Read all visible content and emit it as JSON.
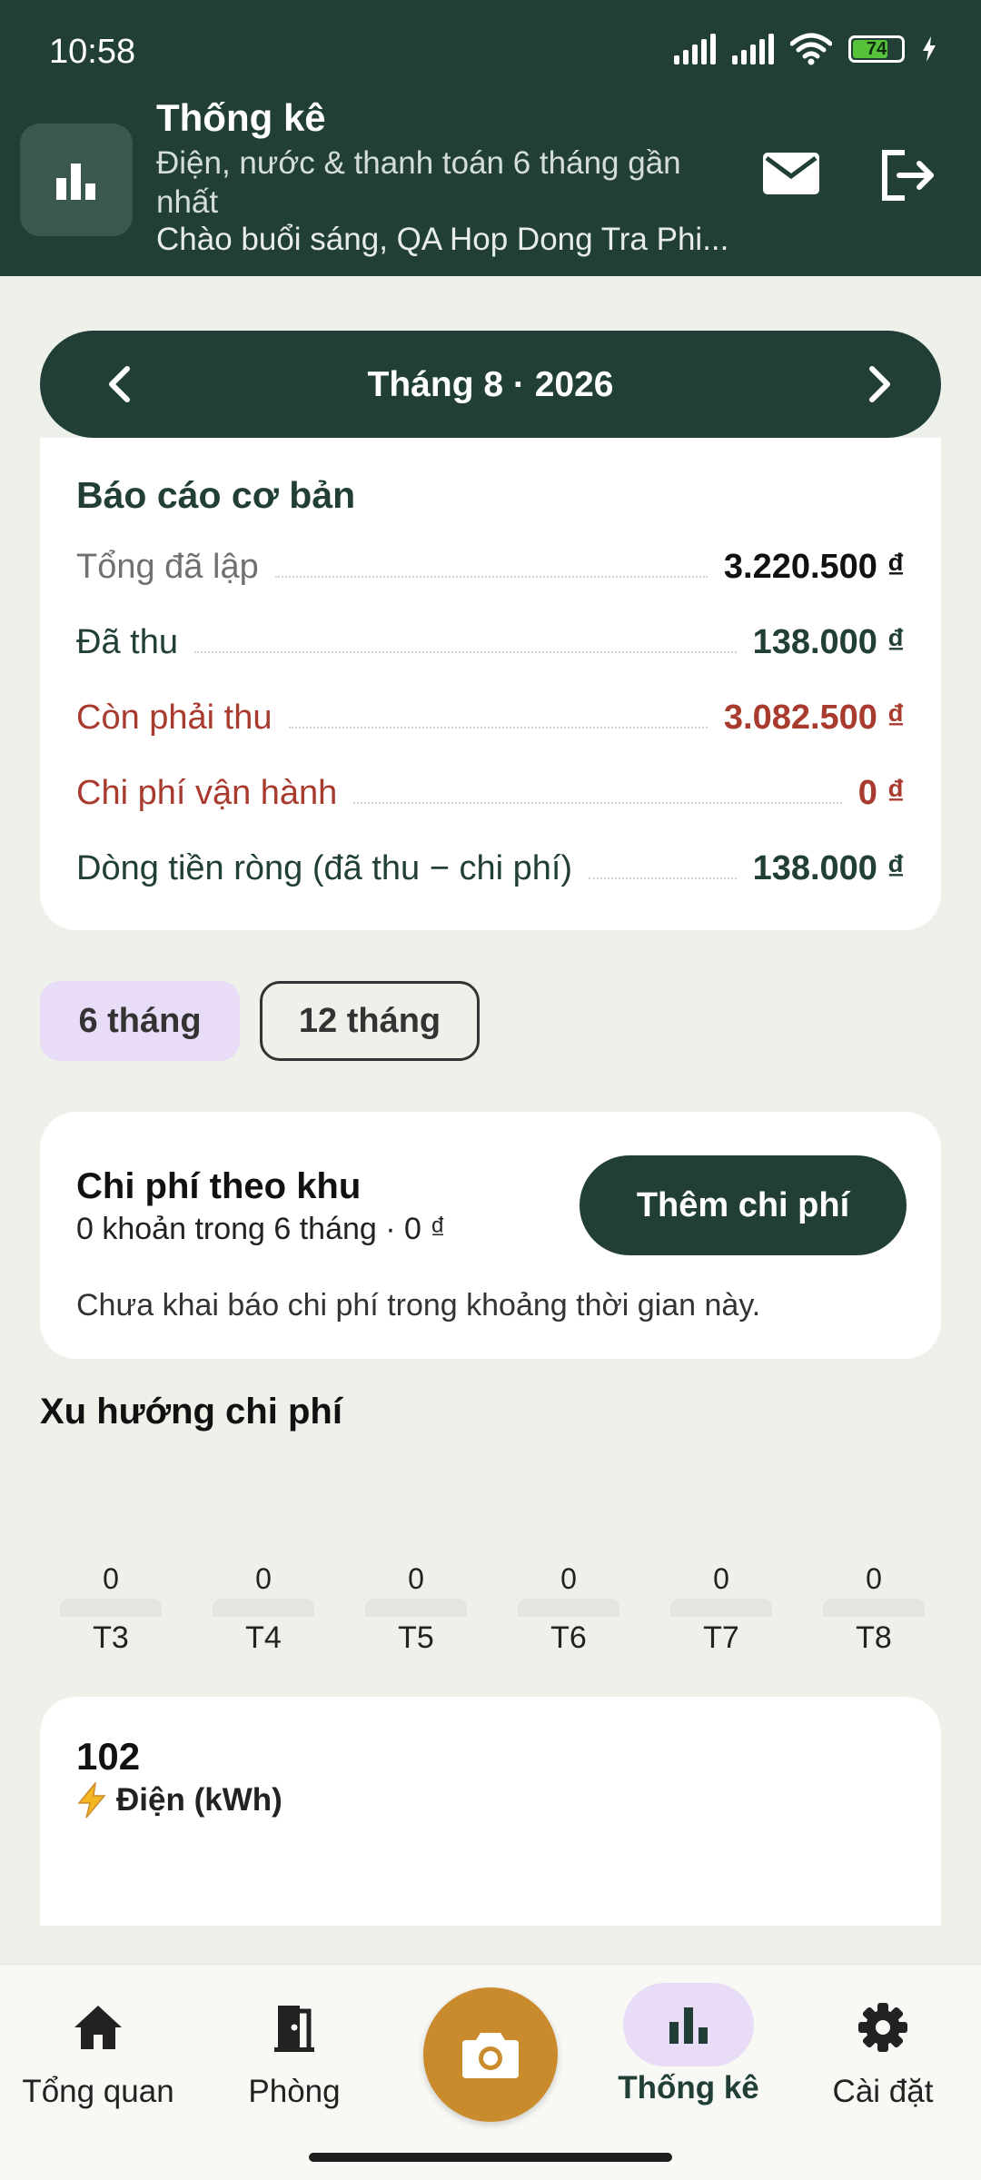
{
  "status_bar": {
    "time": "10:58",
    "battery": "74",
    "battery_level": 0.74
  },
  "header": {
    "title": "Thống kê",
    "subtitle": "Điện, nước & thanh toán 6 tháng gần nhất",
    "greeting": "Chào buổi sáng, QA Hop Dong Tra Phi...",
    "icons": {
      "app": "bar-chart-icon",
      "mail": "mail-icon",
      "logout": "logout-icon"
    }
  },
  "month_nav": {
    "label": "Tháng 8 · 2026"
  },
  "report": {
    "title": "Báo cáo cơ bản",
    "rows": [
      {
        "label": "Tổng đã lập",
        "value": "3.220.500 ₫"
      },
      {
        "label": "Đã thu",
        "value": "138.000 ₫"
      },
      {
        "label": "Còn phải thu",
        "value": "3.082.500 ₫"
      },
      {
        "label": "Chi phí vận hành",
        "value": "0 ₫"
      },
      {
        "label": "Dòng tiền ròng (đã thu − chi phí)",
        "value": "138.000 ₫"
      }
    ]
  },
  "period": {
    "six": "6 tháng",
    "twelve": "12 tháng",
    "selected": "6 tháng"
  },
  "expense": {
    "title": "Chi phí theo khu",
    "subtitle": "0 khoản trong 6 tháng · 0 ₫",
    "add_label": "Thêm chi phí",
    "empty_note": "Chưa khai báo chi phí trong khoảng thời gian này."
  },
  "trend": {
    "title": "Xu hướng chi phí",
    "chart_data": {
      "type": "bar",
      "title": "Xu hướng chi phí",
      "categories": [
        "T3",
        "T4",
        "T5",
        "T6",
        "T7",
        "T8"
      ],
      "values": [
        0,
        0,
        0,
        0,
        0,
        0
      ]
    }
  },
  "electric": {
    "value": "102",
    "icon": "lightning-icon",
    "label": "Điện (kWh)"
  },
  "bottom_nav": {
    "items": [
      {
        "label": "Tổng quan",
        "icon": "home-icon"
      },
      {
        "label": "Phòng",
        "icon": "door-icon"
      },
      {
        "label": "Thống kê",
        "icon": "bar-chart-icon",
        "active": true
      },
      {
        "label": "Cài đặt",
        "icon": "gear-icon"
      }
    ],
    "camera_icon": "camera-icon"
  },
  "colors": {
    "primary": "#213f37",
    "background": "#eef0ea",
    "danger": "#a83a2e",
    "accent": "#c98b2c",
    "chip": "#e8dcf6"
  }
}
